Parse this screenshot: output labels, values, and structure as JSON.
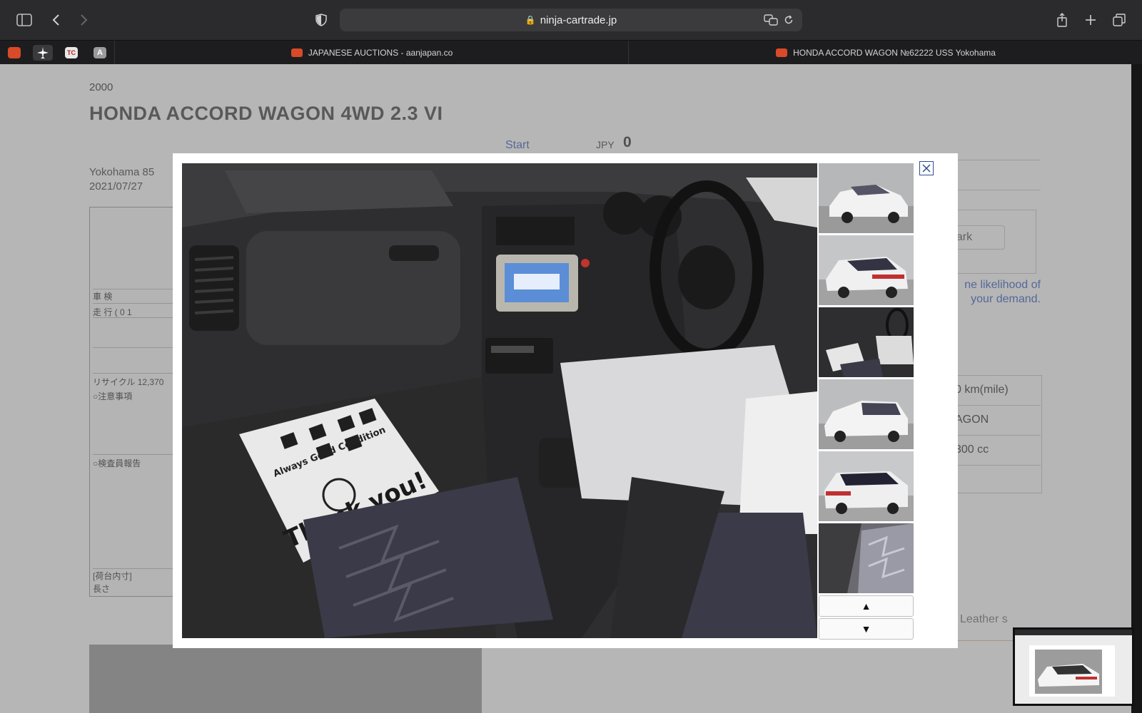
{
  "browser": {
    "url": "ninja-cartrade.jp",
    "tabs": [
      {
        "title": "JAPANESE AUCTIONS - aanjapan.co",
        "active": false
      },
      {
        "title": "HONDA ACCORD WAGON №62222 USS Yokohama",
        "active": true
      }
    ],
    "pinned_tabs": [
      "auction-favicon",
      "airplane-favicon",
      "tc-favicon",
      "a-favicon"
    ],
    "pinned_labels": {
      "tc": "TC",
      "a": "A"
    }
  },
  "listing": {
    "year": "2000",
    "title": "HONDA   ACCORD WAGON 4WD  2.3 VI",
    "location": "Yokohama   85",
    "date": "2021/07/27",
    "start_label": "Start",
    "start_currency": "JPY",
    "start_value": "0",
    "note_line1": "ne likelihood of",
    "note_line2": "your demand.",
    "mark_button": "nark",
    "specs": [
      "0 km(mile)",
      "AGON",
      "300 cc"
    ],
    "leather_label": "Leather s",
    "sheet": {
      "row1": "車 検",
      "row2": "走 行  ( 0 1",
      "row3": "リサイクル  12,370",
      "row4": "○注意事項",
      "row5": "○検査員報告",
      "row6": "[荷台内寸]",
      "row7": "長さ"
    }
  },
  "lightbox": {
    "close_label": "☒",
    "up_label": "▲",
    "down_label": "▼",
    "thumbnails": [
      "front-exterior",
      "rear-exterior",
      "interior-dashboard",
      "front-left-exterior",
      "rear-left-exterior",
      "rear-seats"
    ],
    "bag_text_top": "Always Good Condition",
    "bag_text_bottom": "Thank you!"
  },
  "colors": {
    "link": "#3a62c2",
    "chrome_dark": "#2b2b2d",
    "tab_strip": "#1d1d1f",
    "favicon_red": "#d84a28"
  }
}
